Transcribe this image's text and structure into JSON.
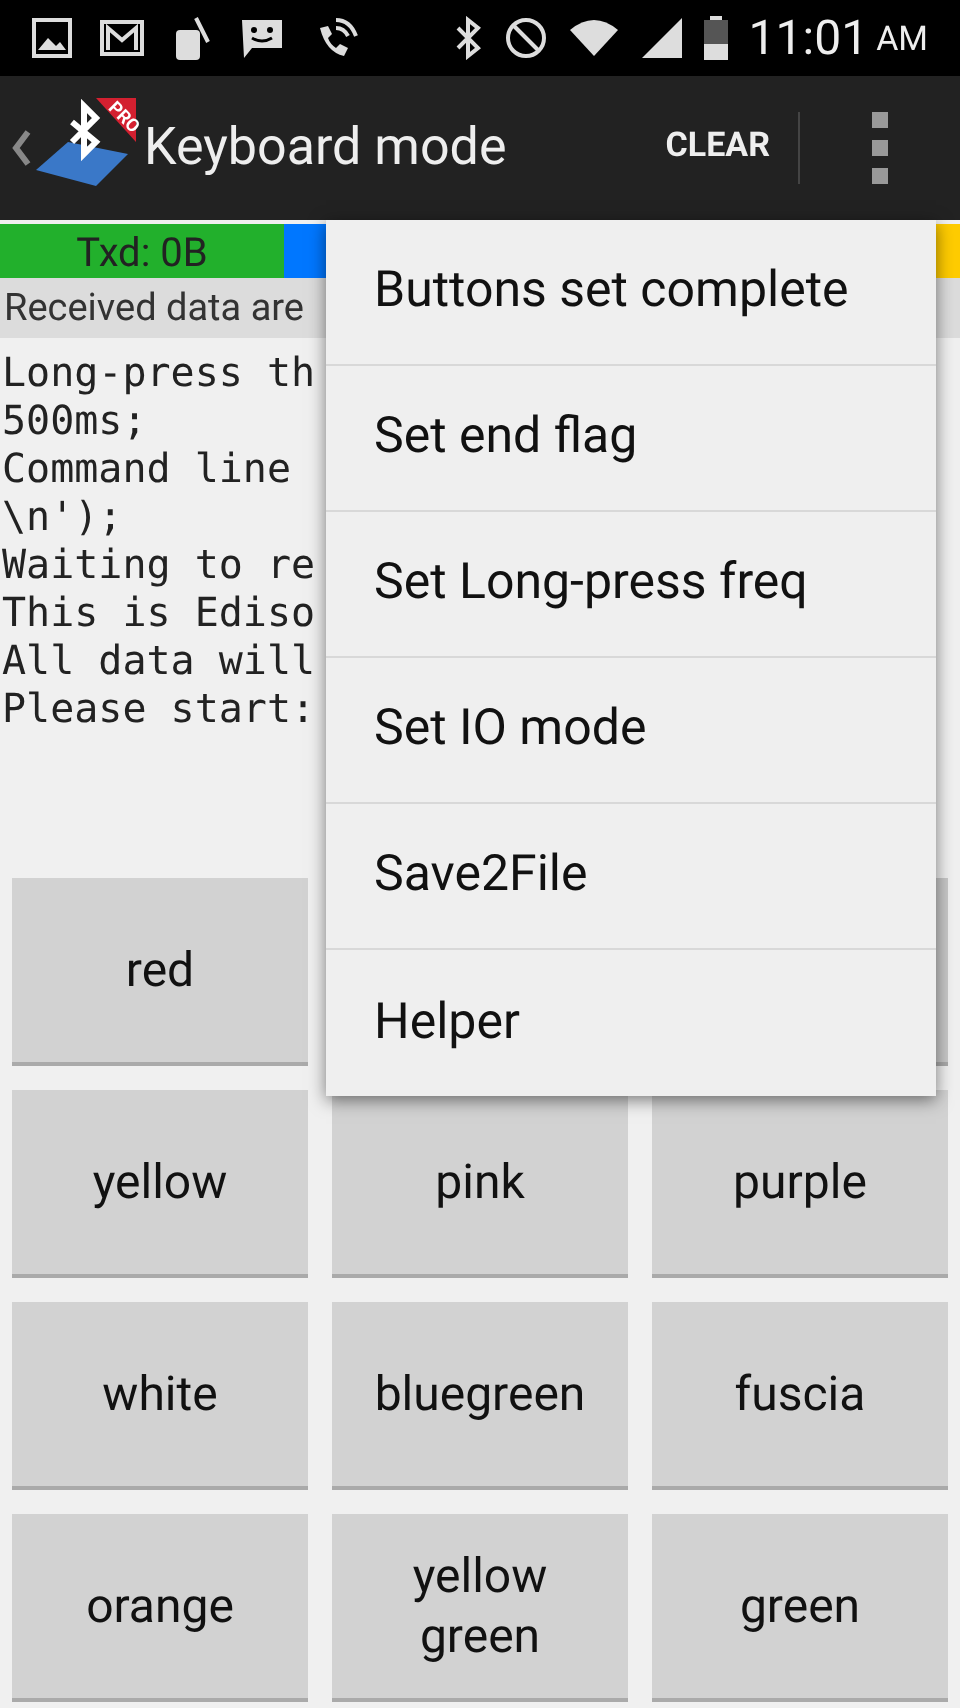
{
  "status_bar": {
    "time": "11:01",
    "am_pm": "AM"
  },
  "action_bar": {
    "title": "Keyboard mode",
    "badge": "PRO",
    "action": "CLEAR"
  },
  "counters": [
    {
      "kind": "txd",
      "label": "Txd: 0B",
      "color": "#22b02c"
    },
    {
      "kind": "rxd",
      "color": "#0077ff"
    },
    {
      "kind": "edge",
      "color": "#ffcc00"
    }
  ],
  "received_header": "Received data are",
  "console_lines": [
    "Long-press th",
    "500ms;",
    "Command line",
    "\\n');",
    "Waiting to re",
    "This is Ediso",
    "All data will",
    "Please start:"
  ],
  "buttons": [
    {
      "label": "red"
    },
    {
      "kind": "hidden"
    },
    {
      "kind": "covered"
    },
    {
      "label": "yellow"
    },
    {
      "label": "pink"
    },
    {
      "label": "purple"
    },
    {
      "label": "white"
    },
    {
      "label": "bluegreen"
    },
    {
      "label": "fuscia"
    },
    {
      "label": "orange"
    },
    {
      "label": "yellow green"
    },
    {
      "label": "green"
    }
  ],
  "menu": {
    "items": [
      "Buttons set complete",
      "Set end flag",
      "Set Long-press freq",
      "Set IO mode",
      "Save2File",
      "Helper"
    ]
  }
}
